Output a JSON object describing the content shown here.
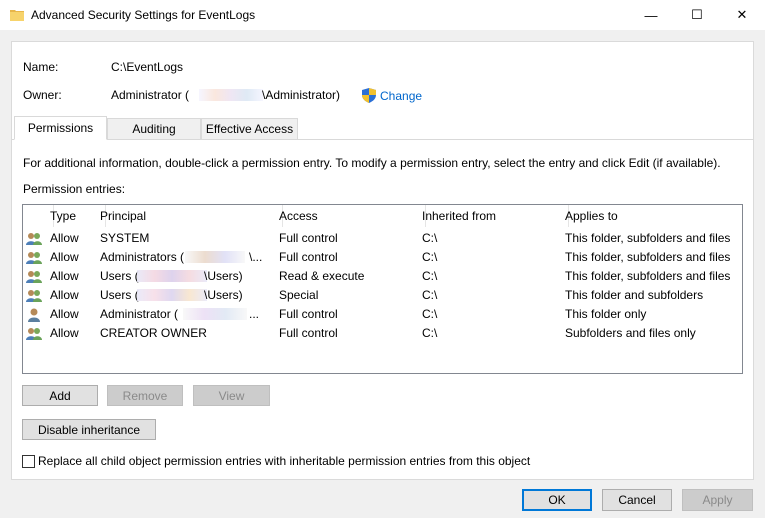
{
  "window": {
    "title": "Advanced Security Settings for EventLogs",
    "minimize_glyph": "—",
    "maximize_glyph": "☐",
    "close_glyph": "✕",
    "icon": "folder-icon"
  },
  "name_label": "Name:",
  "name_value": "C:\\EventLogs",
  "owner_label": "Owner:",
  "owner_prefix": "Administrator (",
  "owner_suffix": "\\Administrator)",
  "change_link": "Change",
  "tabs": [
    {
      "label": "Permissions",
      "active": true
    },
    {
      "label": "Auditing",
      "active": false
    },
    {
      "label": "Effective Access",
      "active": false
    }
  ],
  "info_text": "For additional information, double-click a permission entry. To modify a permission entry, select the entry and click Edit (if available).",
  "entries_label": "Permission entries:",
  "columns": [
    "Type",
    "Principal",
    "Access",
    "Inherited from",
    "Applies to"
  ],
  "rows": [
    {
      "type": "Allow",
      "principal": "SYSTEM",
      "access": "Full control",
      "inherited": "C:\\",
      "applies": "This folder, subfolders and files"
    },
    {
      "type": "Allow",
      "principal": "Administrators (",
      "principal_tail": "\\...",
      "access": "Full control",
      "inherited": "C:\\",
      "applies": "This folder, subfolders and files"
    },
    {
      "type": "Allow",
      "principal": "Users (",
      "principal_tail": "\\Users)",
      "access": "Read & execute",
      "inherited": "C:\\",
      "applies": "This folder, subfolders and files"
    },
    {
      "type": "Allow",
      "principal": "Users (",
      "principal_tail": "\\Users)",
      "access": "Special",
      "inherited": "C:\\",
      "applies": "This folder and subfolders"
    },
    {
      "type": "Allow",
      "principal": "Administrator (",
      "principal_tail": "...",
      "access": "Full control",
      "inherited": "C:\\",
      "applies": "This folder only"
    },
    {
      "type": "Allow",
      "principal": "CREATOR OWNER",
      "access": "Full control",
      "inherited": "C:\\",
      "applies": "Subfolders and files only"
    }
  ],
  "buttons": {
    "add": "Add",
    "remove": "Remove",
    "view": "View",
    "disable_inheritance": "Disable inheritance",
    "ok": "OK",
    "cancel": "Cancel",
    "apply": "Apply"
  },
  "replace_checkbox": {
    "label": "Replace all child object permission entries with inheritable permission entries from this object",
    "checked": false
  },
  "colors": {
    "link": "#0066cc",
    "accent": "#0078d7",
    "window_bg": "#f0f0f0",
    "panel_bg": "#ffffff"
  }
}
